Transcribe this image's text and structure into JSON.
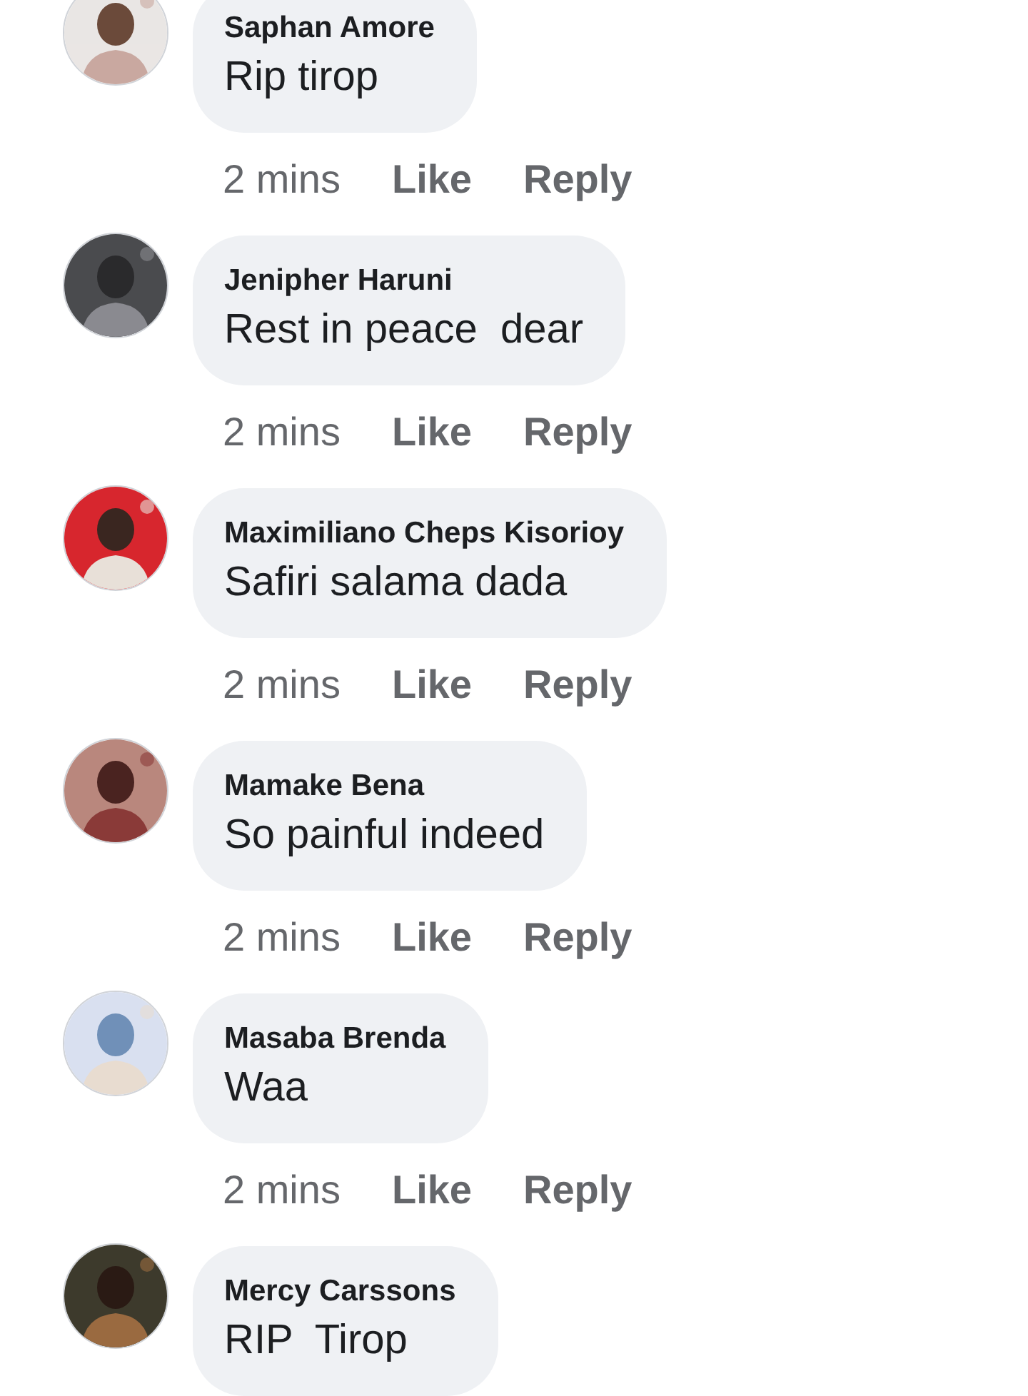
{
  "comments": [
    {
      "author": "Saphan Amore",
      "text": "Rip tirop",
      "time": "2 mins",
      "actions": [
        "Like",
        "Reply"
      ]
    },
    {
      "author": "Jenipher Haruni",
      "text": "Rest in peace  dear",
      "time": "2 mins",
      "actions": [
        "Like",
        "Reply"
      ]
    },
    {
      "author": "Maximiliano Cheps Kisorioy",
      "text": "Safiri salama dada",
      "time": "2 mins",
      "actions": [
        "Like",
        "Reply"
      ]
    },
    {
      "author": "Mamake Bena",
      "text": "So painful indeed",
      "time": "2 mins",
      "actions": [
        "Like",
        "Reply"
      ]
    },
    {
      "author": "Masaba Brenda",
      "text": "Waa",
      "time": "2 mins",
      "actions": [
        "Like",
        "Reply"
      ]
    },
    {
      "author": "Mercy Carssons",
      "text": "RIP  Tirop"
    }
  ]
}
